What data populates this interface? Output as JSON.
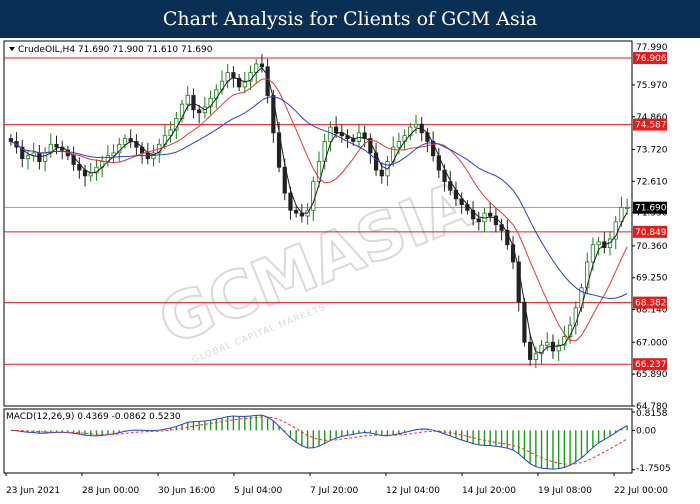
{
  "banner": {
    "title": "Chart Analysis for Clients of GCM Asia"
  },
  "watermark": {
    "main": "GCMASIA",
    "sub": "GLOBAL CAPITAL MARKETS",
    "color": "#d9d9d9"
  },
  "chart_data": [
    {
      "type": "candlestick",
      "title": "CrudeOIL,H4  71.690 71.900 71.610 71.690",
      "instrument": "CrudeOIL,H4",
      "ohlc_header": {
        "open": 71.69,
        "high": 71.9,
        "low": 71.61,
        "close": 71.69
      },
      "ylim": [
        64.78,
        77.5
      ],
      "y_ticks": [
        "77.990",
        "76.906",
        "75.970",
        "74.860",
        "74.587",
        "73.720",
        "72.610",
        "71.690",
        "71.530",
        "70.849",
        "70.360",
        "69.250",
        "68.382",
        "68.140",
        "67.000",
        "66.237",
        "65.890",
        "64.780"
      ],
      "x_ticks": [
        "23 Jun 2021",
        "28 Jun 00:00",
        "30 Jun 16:00",
        "5 Jul 04:00",
        "7 Jul 20:00",
        "12 Jul 04:00",
        "14 Jul 20:00",
        "19 Jul 08:00",
        "22 Jul 00:00"
      ],
      "horizontal_levels": [
        {
          "value": 76.906,
          "label": "76.906",
          "color": "#e31c1c"
        },
        {
          "value": 74.587,
          "label": "74.587",
          "color": "#e31c1c"
        },
        {
          "value": 70.849,
          "label": "70.849",
          "color": "#e31c1c"
        },
        {
          "value": 68.382,
          "label": "68.382",
          "color": "#e31c1c"
        },
        {
          "value": 66.237,
          "label": "66.237",
          "color": "#e31c1c"
        }
      ],
      "current_price": {
        "value": 71.69,
        "label": "71.690",
        "line_color": "#4a6fa5"
      },
      "close": [
        74.0,
        73.8,
        73.4,
        73.5,
        73.6,
        73.3,
        73.6,
        73.9,
        73.8,
        73.7,
        73.5,
        73.2,
        73.0,
        72.8,
        72.9,
        73.1,
        73.3,
        73.5,
        73.6,
        73.9,
        74.1,
        74.0,
        73.8,
        73.6,
        73.4,
        73.6,
        73.9,
        74.2,
        74.4,
        74.8,
        75.3,
        75.6,
        75.1,
        75.0,
        75.2,
        75.5,
        75.8,
        76.1,
        76.4,
        76.2,
        75.9,
        76.1,
        76.4,
        76.7,
        76.6,
        75.6,
        74.3,
        73.1,
        72.2,
        71.6,
        71.5,
        71.4,
        71.6,
        72.6,
        73.3,
        74.0,
        74.5,
        74.3,
        74.2,
        74.1,
        74.0,
        74.3,
        74.1,
        73.6,
        73.0,
        72.8,
        73.3,
        73.8,
        74.0,
        74.2,
        74.5,
        74.6,
        74.3,
        74.0,
        73.5,
        73.0,
        72.6,
        72.3,
        72.0,
        71.8,
        71.6,
        71.3,
        71.2,
        71.5,
        71.4,
        71.1,
        70.9,
        70.4,
        69.8,
        68.4,
        67.0,
        66.4,
        66.6,
        66.9,
        67.0,
        66.7,
        66.9,
        67.2,
        67.6,
        68.2,
        68.9,
        69.8,
        70.4,
        70.5,
        70.3,
        70.6,
        71.2,
        71.7,
        71.7
      ],
      "ma_fast": {
        "name": "",
        "color": "#222222"
      },
      "ma_mid": {
        "name": "",
        "color": "#e43a3a"
      },
      "ma_slow": {
        "name": "",
        "color": "#2a3fd0"
      },
      "up_color": "#1a7d1a",
      "down_color": "#222222"
    },
    {
      "type": "bar",
      "title": "MACD(12,26,9) 0.4369 -0.0862 0.5230",
      "label_values": {
        "macd": 0.4369,
        "signal": -0.0862,
        "hist": 0.523
      },
      "ylim": [
        -1.9,
        0.95
      ],
      "y_ticks": [
        "0.8158",
        "0.00",
        "-1.7505"
      ],
      "hist_color": "#1a9a1a",
      "macd_line_color": "#2a3fd0",
      "signal_line_color": "#e43a3a"
    }
  ]
}
